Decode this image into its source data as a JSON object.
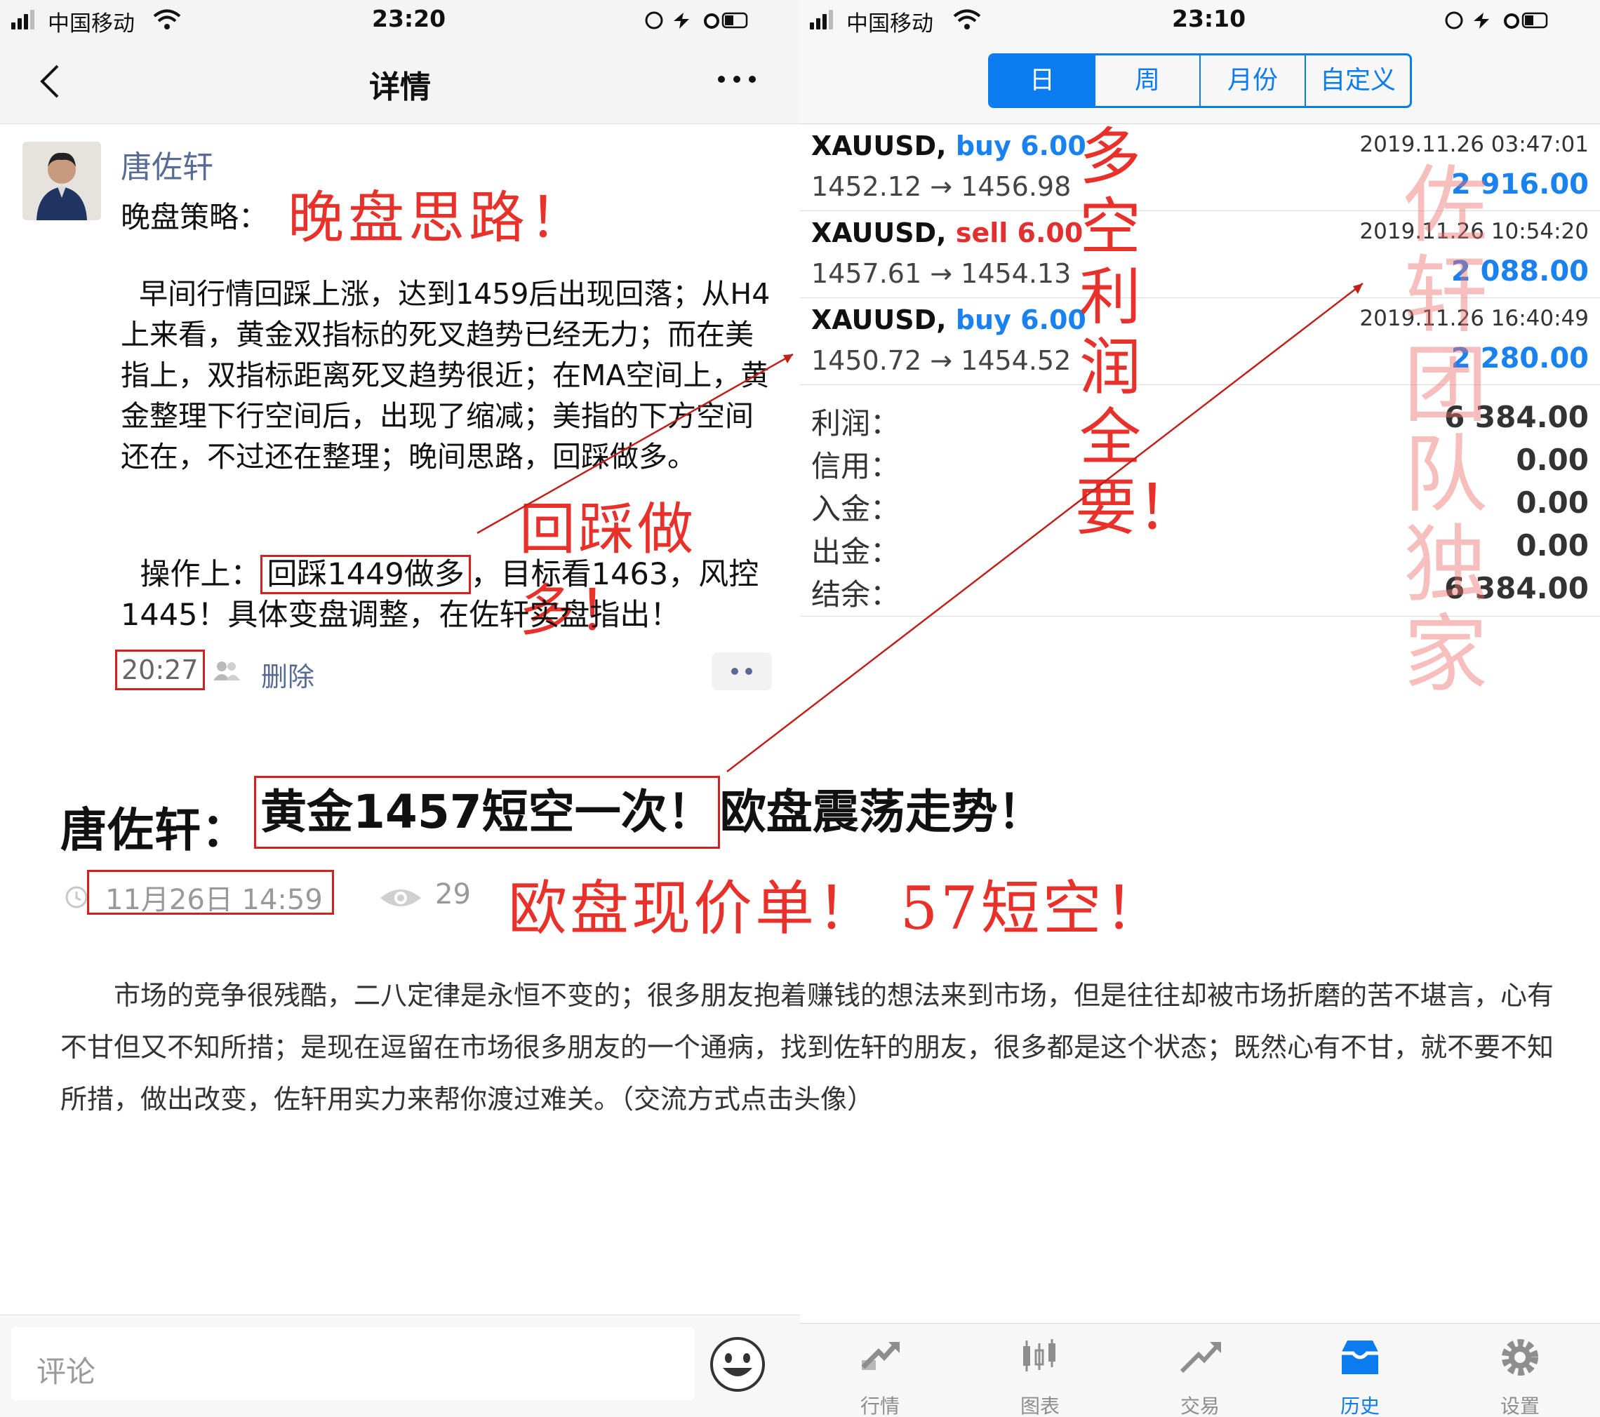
{
  "left": {
    "status": {
      "carrier": "中国移动",
      "time": "23:20"
    },
    "nav": {
      "title": "详情"
    },
    "author": "唐佐轩",
    "strategy_label": "晚盘策略：",
    "annotation_title": "晚盘思路！",
    "paragraph": "  早间行情回踩上涨，达到1459后出现回落；从H4上来看，黄金双指标的死叉趋势已经无力；而在美指上，双指标距离死叉趋势很近；在MA空间上，黄金整理下行空间后，出现了缩减；美指的下方空间还在，不过还在整理；晚间思路，回踩做多。",
    "annotation_mid": "回踩做多！",
    "op_prefix": "  操作上：",
    "op_boxed": "回踩1449做多",
    "op_suffix": "，目标看1463，风控1445！具体变盘调整，在佐轩实盘指出！",
    "post_time": "20:27",
    "delete_label": "删除",
    "headline_prefix": "唐佐轩：",
    "headline_boxed": "黄金1457短空一次！",
    "headline_suffix": "欧盘震荡走势！",
    "date": "11月26日 14:59",
    "views": "29",
    "annotation_bottom": "欧盘现价单！ 57短空！",
    "article": "　　市场的竞争很残酷，二八定律是永恒不变的；很多朋友抱着赚钱的想法来到市场，但是往往却被市场折磨的苦不堪言，心有不甘但又不知所措；是现在逗留在市场很多朋友的一个通病，找到佐轩的朋友，很多都是这个状态；既然心有不甘，就不要不知所措，做出改变，佐轩用实力来帮你渡过难关。（交流方式点击头像）",
    "comment_placeholder": "评论"
  },
  "right": {
    "status": {
      "carrier": "中国移动",
      "time": "23:10"
    },
    "segments": [
      {
        "label": "日",
        "active": true
      },
      {
        "label": "周",
        "active": false
      },
      {
        "label": "月份",
        "active": false
      },
      {
        "label": "自定义",
        "active": false
      }
    ],
    "trades": [
      {
        "symbol": "XAUUSD,",
        "side": "buy 6.00",
        "type": "buy",
        "prices": "1452.12 → 1456.98",
        "datetime": "2019.11.26 03:47:01",
        "profit": "2 916.00"
      },
      {
        "symbol": "XAUUSD,",
        "side": "sell 6.00",
        "type": "sell",
        "prices": "1457.61 → 1454.13",
        "datetime": "2019.11.26 10:54:20",
        "profit": "2 088.00"
      },
      {
        "symbol": "XAUUSD,",
        "side": "buy 6.00",
        "type": "buy",
        "prices": "1450.72 → 1454.52",
        "datetime": "2019.11.26 16:40:49",
        "profit": "2 280.00"
      }
    ],
    "summary": [
      {
        "label": "利润：",
        "value": "6 384.00"
      },
      {
        "label": "信用：",
        "value": "0.00"
      },
      {
        "label": "入金：",
        "value": "0.00"
      },
      {
        "label": "出金：",
        "value": "0.00"
      },
      {
        "label": "结余：",
        "value": "6 384.00"
      }
    ],
    "annotation_vertical": "多空利润全要！",
    "watermark": "佐轩团队独家",
    "tabs": [
      {
        "label": "行情",
        "icon": "quotes-icon",
        "active": false
      },
      {
        "label": "图表",
        "icon": "chart-icon",
        "active": false
      },
      {
        "label": "交易",
        "icon": "trade-icon",
        "active": false
      },
      {
        "label": "历史",
        "icon": "history-icon",
        "active": true
      },
      {
        "label": "设置",
        "icon": "settings-icon",
        "active": false
      }
    ]
  },
  "colors": {
    "accent": "#0b7cf0",
    "annotation_red": "#e8312b",
    "sell_red": "#e23030",
    "link": "#576b95"
  }
}
